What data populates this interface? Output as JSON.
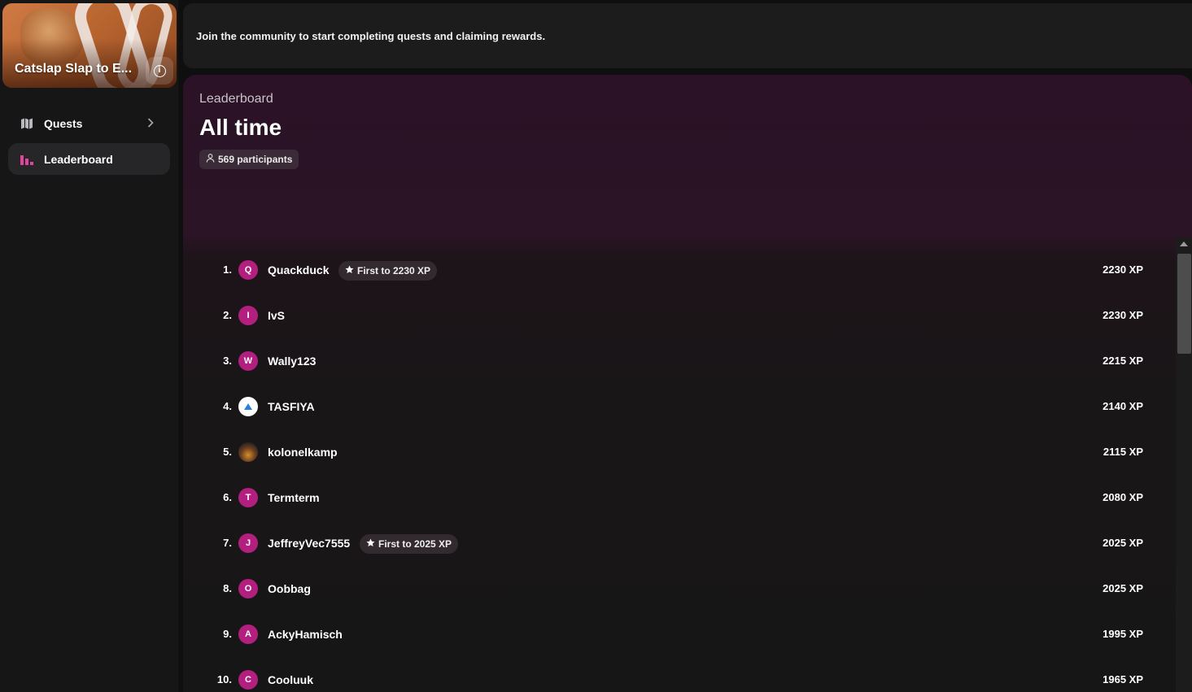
{
  "sidebar": {
    "community_title": "Catslap Slap to E...",
    "info_glyph": "i",
    "items": [
      {
        "label": "Quests",
        "icon": "map-icon",
        "has_chevron": true,
        "active": false
      },
      {
        "label": "Leaderboard",
        "icon": "bar-chart-icon",
        "has_chevron": false,
        "active": true
      }
    ]
  },
  "topcard": {
    "message": "Join the community to start completing quests and claiming rewards."
  },
  "leaderboard": {
    "subtitle": "Leaderboard",
    "title": "All time",
    "participants": "569 participants",
    "accent_color": "#b21f7f",
    "rows": [
      {
        "rank": "1.",
        "initial": "Q",
        "name": "Quackduck",
        "badge": "First to 2230 XP",
        "xp": "2230 XP",
        "avatar": "letter"
      },
      {
        "rank": "2.",
        "initial": "I",
        "name": "IvS",
        "badge": "",
        "xp": "2230 XP",
        "avatar": "letter"
      },
      {
        "rank": "3.",
        "initial": "W",
        "name": "Wally123",
        "badge": "",
        "xp": "2215 XP",
        "avatar": "letter"
      },
      {
        "rank": "4.",
        "initial": "",
        "name": "TASFIYA",
        "badge": "",
        "xp": "2140 XP",
        "avatar": "logo"
      },
      {
        "rank": "5.",
        "initial": "",
        "name": "kolonelkamp",
        "badge": "",
        "xp": "2115 XP",
        "avatar": "photo"
      },
      {
        "rank": "6.",
        "initial": "T",
        "name": "Termterm",
        "badge": "",
        "xp": "2080 XP",
        "avatar": "letter"
      },
      {
        "rank": "7.",
        "initial": "J",
        "name": "JeffreyVec7555",
        "badge": "First to 2025 XP",
        "xp": "2025 XP",
        "avatar": "letter"
      },
      {
        "rank": "8.",
        "initial": "O",
        "name": "Oobbag",
        "badge": "",
        "xp": "2025 XP",
        "avatar": "letter"
      },
      {
        "rank": "9.",
        "initial": "A",
        "name": "AckyHamisch",
        "badge": "",
        "xp": "1995 XP",
        "avatar": "letter"
      },
      {
        "rank": "10.",
        "initial": "C",
        "name": "Cooluuk",
        "badge": "",
        "xp": "1965 XP",
        "avatar": "letter"
      }
    ]
  }
}
